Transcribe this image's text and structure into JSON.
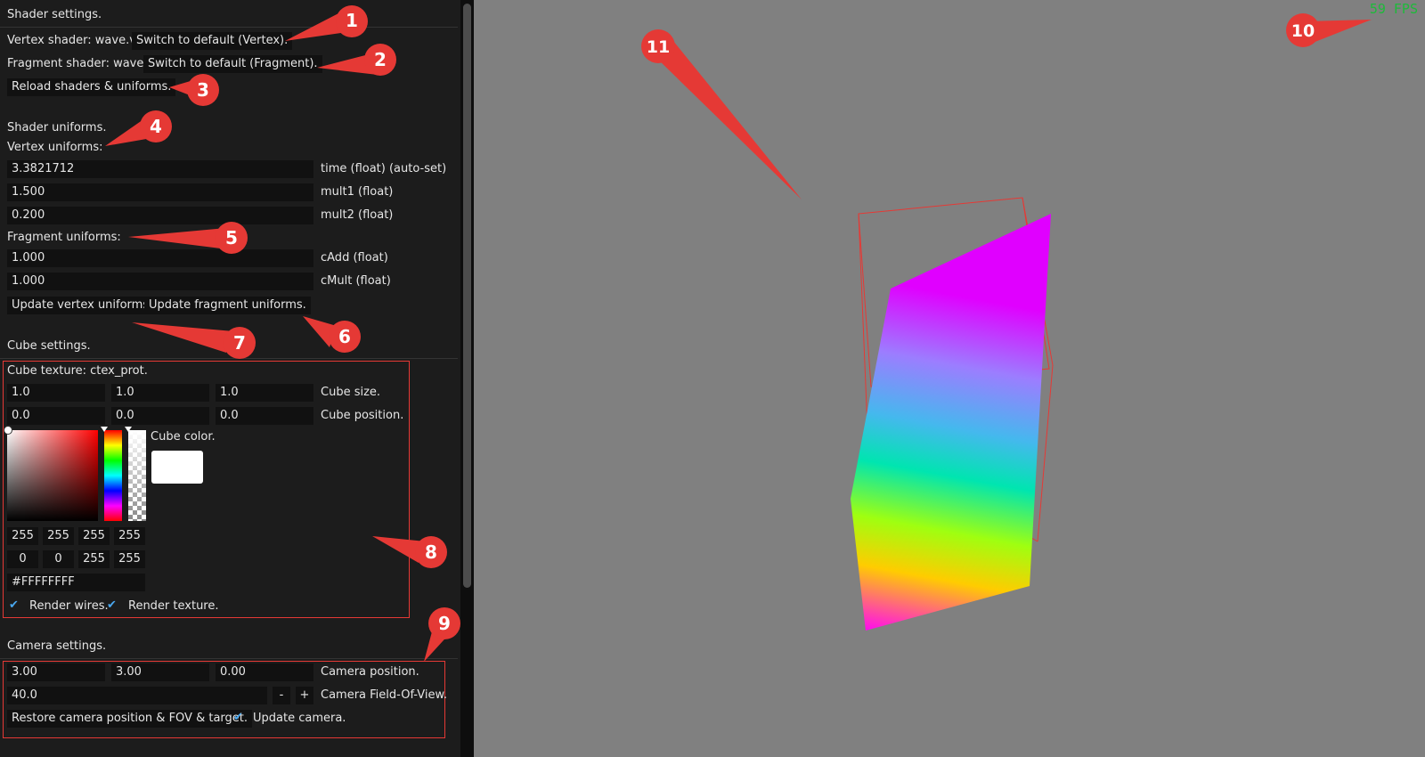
{
  "shader_settings": {
    "header": "Shader settings.",
    "vertex_label": "Vertex shader: wave.vs",
    "vertex_default_btn": "Switch to default (Vertex).",
    "fragment_label": "Fragment shader: wave.fs",
    "fragment_default_btn": "Switch to default (Fragment).",
    "reload_btn": "Reload shaders & uniforms."
  },
  "uniforms": {
    "header": "Shader uniforms.",
    "vertex_header": "Vertex uniforms:",
    "vertex": [
      {
        "value": "3.3821712",
        "label": "time (float) (auto-set)"
      },
      {
        "value": "1.500",
        "label": "mult1 (float)"
      },
      {
        "value": "0.200",
        "label": "mult2 (float)"
      }
    ],
    "fragment_header": "Fragment uniforms:",
    "fragment": [
      {
        "value": "1.000",
        "label": "cAdd (float)"
      },
      {
        "value": "1.000",
        "label": "cMult (float)"
      }
    ],
    "update_vertex_btn": "Update vertex uniforms.",
    "update_fragment_btn": "Update fragment uniforms."
  },
  "cube": {
    "header": "Cube settings.",
    "texture_label": "Cube texture: ctex_prot.",
    "size": [
      "1.0",
      "1.0",
      "1.0"
    ],
    "size_label": "Cube size.",
    "position": [
      "0.0",
      "0.0",
      "0.0"
    ],
    "position_label": "Cube position.",
    "color_label": "Cube color.",
    "swatch_color": "#ffffff",
    "rgba": [
      "255",
      "255",
      "255",
      "255"
    ],
    "hsva": [
      "0",
      "0",
      "255",
      "255"
    ],
    "hex": "#FFFFFFFF",
    "render_wires": "Render wires.",
    "render_texture": "Render texture."
  },
  "camera": {
    "header": "Camera settings.",
    "position": [
      "3.00",
      "3.00",
      "0.00"
    ],
    "position_label": "Camera position.",
    "fov": "40.0",
    "minus": "-",
    "plus": "+",
    "fov_label": "Camera Field-Of-View.",
    "restore_btn": "Restore camera position & FOV & target.",
    "update_label": "Update camera."
  },
  "viewport": {
    "fps": "59 FPS"
  },
  "annotations": [
    "1",
    "2",
    "3",
    "4",
    "5",
    "6",
    "7",
    "8",
    "9",
    "10",
    "11"
  ],
  "colors": {
    "panel_bg": "#1c1c1c",
    "viewport_bg": "#808080",
    "accent_red": "#e53935",
    "fps_green": "#1dba3a",
    "check_blue": "#4aa8ef"
  }
}
